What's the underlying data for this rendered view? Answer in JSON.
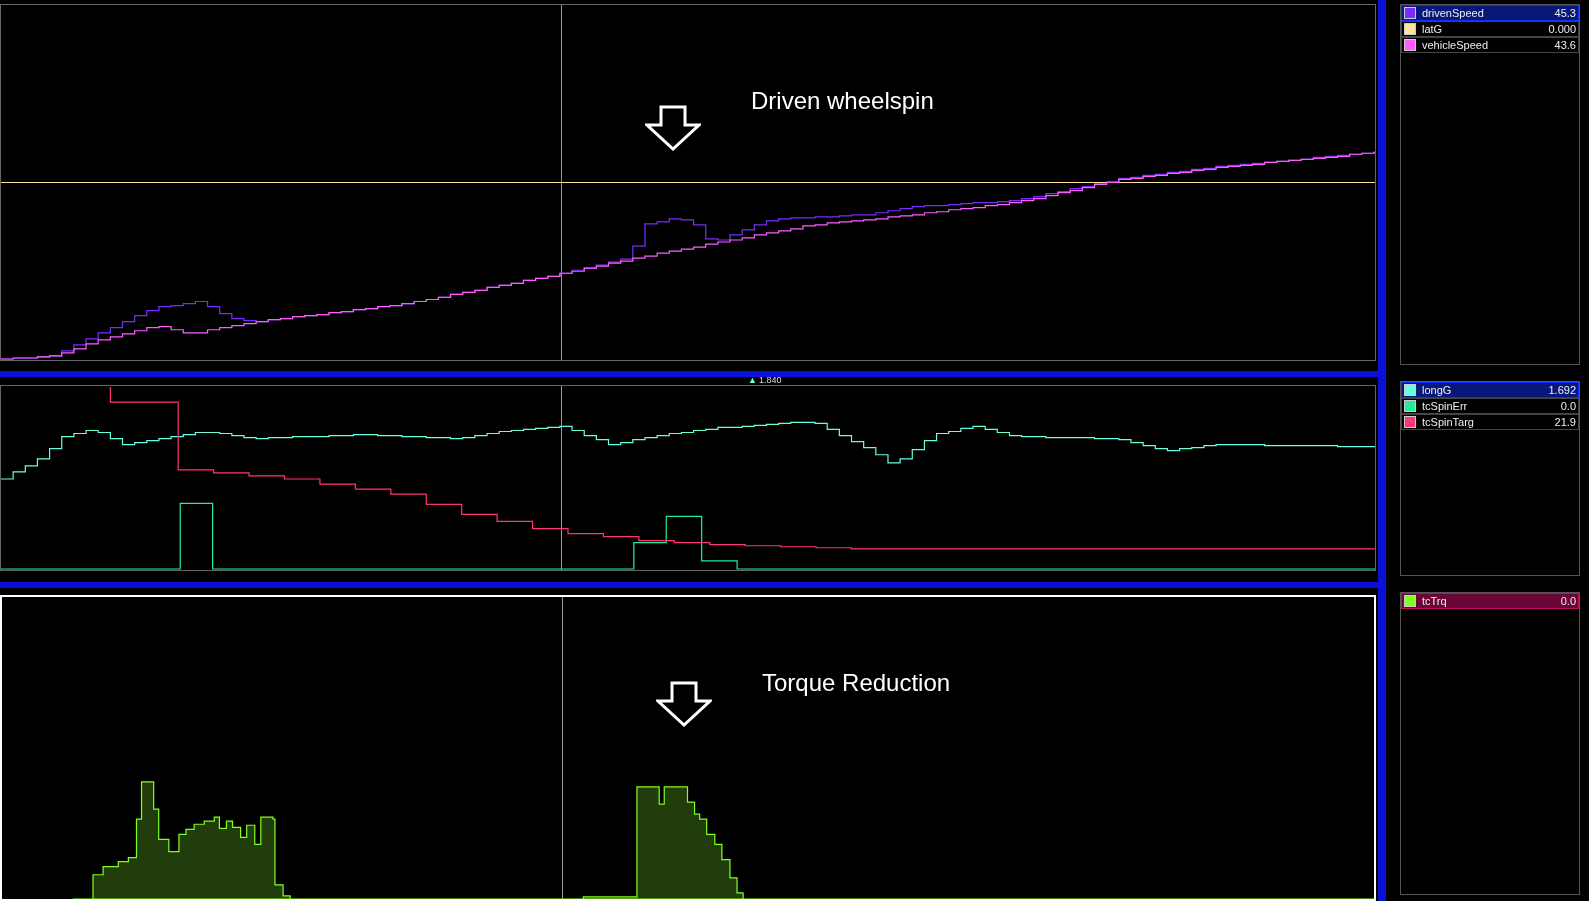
{
  "panels": [
    {
      "active": false,
      "annotation": {
        "text": "Driven wheelspin"
      },
      "legend": [
        {
          "name": "drivenSpeed",
          "value": "45.3",
          "color": "#7a2cff",
          "selected": true,
          "alarm": false
        },
        {
          "name": "latG",
          "value": "0.000",
          "color": "#ffe39a",
          "selected": false,
          "alarm": false
        },
        {
          "name": "vehicleSpeed",
          "value": "43.6",
          "color": "#ff5cff",
          "selected": false,
          "alarm": false
        }
      ]
    },
    {
      "active": false,
      "marker": {
        "symbol": "▲",
        "value": "1.840"
      },
      "legend": [
        {
          "name": "longG",
          "value": "1.692",
          "color": "#66ffe0",
          "selected": true,
          "alarm": false
        },
        {
          "name": "tcSpinErr",
          "value": "0.0",
          "color": "#22ee99",
          "selected": false,
          "alarm": false
        },
        {
          "name": "tcSpinTarg",
          "value": "21.9",
          "color": "#ff3377",
          "selected": false,
          "alarm": false
        }
      ]
    },
    {
      "active": true,
      "annotation": {
        "text": "Torque Reduction"
      },
      "legend": [
        {
          "name": "tcTrq",
          "value": "0.0",
          "color": "#80ff20",
          "selected": false,
          "alarm": true
        }
      ]
    }
  ]
}
